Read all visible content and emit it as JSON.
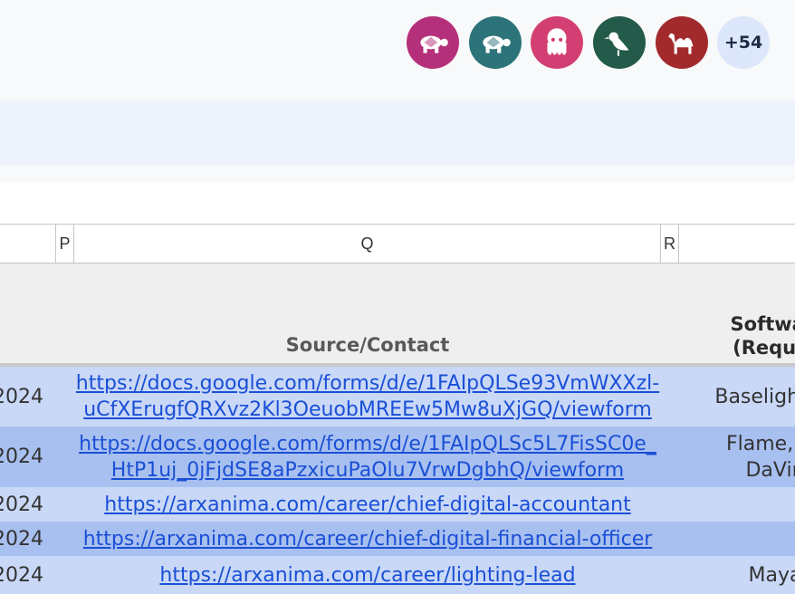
{
  "collaborators": {
    "avatars": [
      {
        "name": "turtle-icon",
        "color": "#b5307a"
      },
      {
        "name": "turtle-icon",
        "color": "#2c7479"
      },
      {
        "name": "squid-icon",
        "color": "#d33f73"
      },
      {
        "name": "bird-icon",
        "color": "#245a4a"
      },
      {
        "name": "camel-icon",
        "color": "#a32a2c"
      }
    ],
    "more_count": "+54"
  },
  "columns": {
    "p": "P",
    "q": "Q",
    "r": "R"
  },
  "header": {
    "source": "Source/Contact",
    "software_line1": "Software",
    "software_line2": "(Require"
  },
  "rows": [
    {
      "date": "2024",
      "link_line1": "https://docs.google.com/forms/d/e/1FAIpQLSe93VmWXXzl-",
      "link_line2": "uCfXErugfQRXvz2Kl3OeuobMREEw5Mw8uXjGQ/viewform",
      "software_line1": "Baselight, D",
      "software_line2": ""
    },
    {
      "date": "2024",
      "link_line1": "https://docs.google.com/forms/d/e/1FAIpQLSc5L7FisSC0e_",
      "link_line2": "HtP1uj_0jFjdSE8aPzxicuPaOlu7VrwDgbhQ/viewform",
      "software_line1": "Flame, Av",
      "software_line2": "DaVin"
    },
    {
      "date": "2024",
      "link_line1": "https://arxanima.com/career/chief-digital-accountant",
      "link_line2": "",
      "software_line1": "",
      "software_line2": ""
    },
    {
      "date": "2024",
      "link_line1": "https://arxanima.com/career/chief-digital-financial-officer",
      "link_line2": "",
      "software_line1": "",
      "software_line2": ""
    },
    {
      "date": "2024",
      "link_line1": "https://arxanima.com/career/lighting-lead",
      "link_line2": "",
      "software_line1": "Maya",
      "software_line2": ""
    }
  ]
}
